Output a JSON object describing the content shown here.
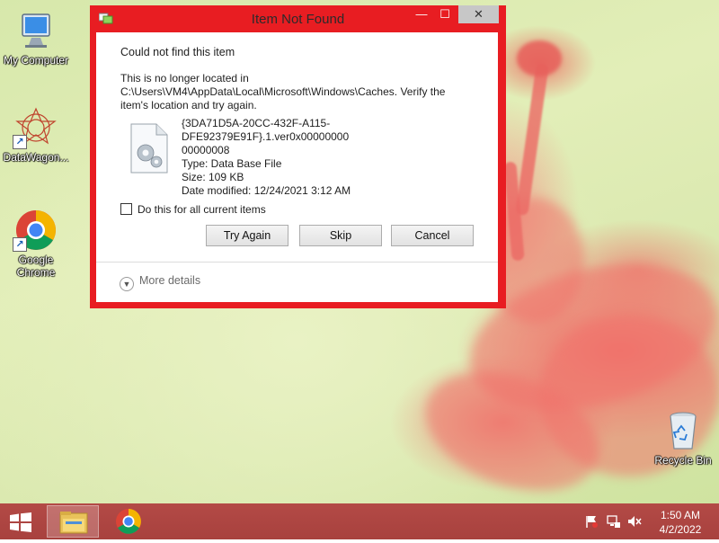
{
  "desktop": {
    "icons": [
      {
        "label": "My Computer"
      },
      {
        "label": "DataWagon..."
      },
      {
        "label": "Google Chrome"
      },
      {
        "label": "Recycle Bin"
      }
    ]
  },
  "dialog": {
    "title": "Item Not Found",
    "titlebar_buttons": {
      "minimize": "—",
      "maximize": "☐",
      "close": "✕"
    },
    "heading": "Could not find this item",
    "message_line1": "This is no longer located in",
    "message_line2": "C:\\Users\\VM4\\AppData\\Local\\Microsoft\\Windows\\Caches. Verify the",
    "message_line3": "item's location and try again.",
    "file": {
      "name_line1": "{3DA71D5A-20CC-432F-A115-DFE92379E91F}.1.ver0x00000000",
      "name_line2": "00000008",
      "type": "Type: Data Base File",
      "size": "Size: 109 KB",
      "modified": "Date modified: 12/24/2021 3:12 AM"
    },
    "checkbox_label": "Do this for all current items",
    "checkbox_checked": false,
    "buttons": {
      "try_again": "Try Again",
      "skip": "Skip",
      "cancel": "Cancel"
    },
    "more_details": "More details",
    "border_color": "#e81d22"
  },
  "taskbar": {
    "pinned": [
      {
        "name": "file-explorer",
        "active": true
      },
      {
        "name": "google-chrome",
        "active": false
      }
    ],
    "tray_icons": [
      "action-center-flag-icon",
      "network-icon",
      "volume-muted-icon"
    ],
    "clock": {
      "time": "1:50 AM",
      "date": "4/2/2022"
    },
    "color": "#b34a46"
  }
}
